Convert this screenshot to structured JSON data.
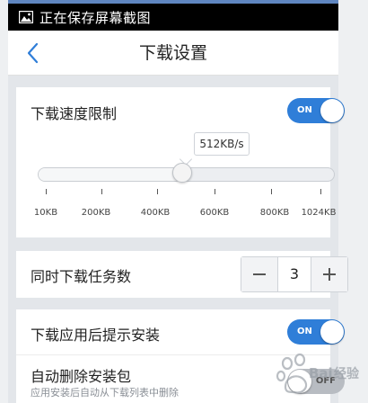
{
  "statusbar": {
    "icon": "image-icon",
    "text": "正在保存屏幕截图"
  },
  "nav": {
    "back_icon": "chevron-left-icon",
    "title": "下载设置"
  },
  "speed_limit": {
    "label": "下载速度限制",
    "toggle": {
      "state": "on",
      "label": "ON"
    },
    "bubble_value": "512KB/s",
    "slider_fraction": 0.5,
    "ticks": [
      "10KB",
      "200KB",
      "400KB",
      "600KB",
      "800KB",
      "1024KB"
    ]
  },
  "concurrent": {
    "label": "同时下载任务数",
    "minus_icon": "minus-icon",
    "value": "3",
    "plus_icon": "plus-icon"
  },
  "install_prompt": {
    "label": "下载应用后提示安装",
    "toggle": {
      "state": "on",
      "label": "ON"
    }
  },
  "auto_delete": {
    "label": "自动删除安装包",
    "sublabel": "应用安装后自动从下载列表中删除",
    "toggle": {
      "state": "off",
      "label": "OFF"
    }
  },
  "watermark": {
    "text": "Baidu 经验"
  },
  "colors": {
    "accent": "#2f7ed8",
    "statusbar": "#000000",
    "background": "#e3e6ea"
  }
}
